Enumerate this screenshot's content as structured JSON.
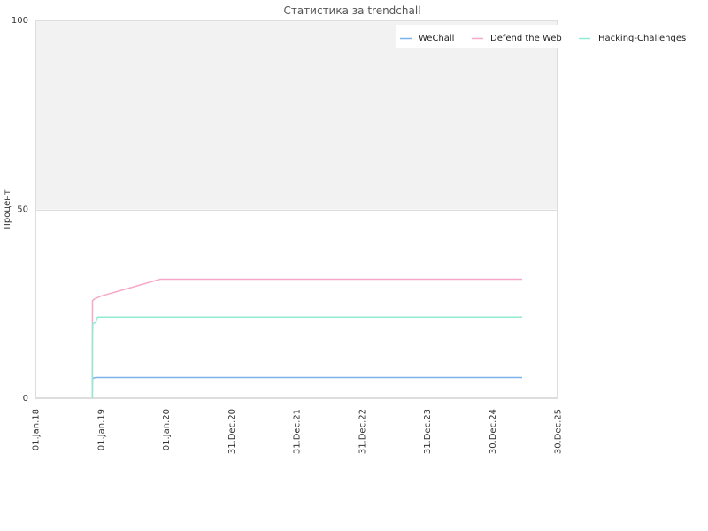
{
  "chart_data": {
    "type": "line",
    "title": "Статистика за trendchall",
    "xlabel": "",
    "ylabel": "Процент",
    "ylim": [
      0,
      100
    ],
    "yticks": [
      0,
      50,
      100
    ],
    "xlim": [
      "2018-01-01",
      "2025-12-30"
    ],
    "xtick_labels": [
      "01.Jan.18",
      "01.Jan.19",
      "01.Jan.20",
      "31.Dec.20",
      "31.Dec.21",
      "31.Dec.22",
      "31.Dec.23",
      "30.Dec.24",
      "30.Dec.25"
    ],
    "xtick_dates": [
      "2018-01-01",
      "2019-01-01",
      "2020-01-01",
      "2020-12-31",
      "2021-12-31",
      "2022-12-31",
      "2023-12-31",
      "2024-12-30",
      "2025-12-30"
    ],
    "shaded_band": {
      "from": 50,
      "to": 100,
      "color": "#f2f2f2"
    },
    "legend_position": "top-right",
    "series": [
      {
        "name": "WeChall",
        "color": "#7cb5ec",
        "points": [
          [
            "2018-11-15",
            0
          ],
          [
            "2018-11-16",
            5.2
          ],
          [
            "2018-11-25",
            5.4
          ],
          [
            "2018-12-10",
            5.5
          ],
          [
            "2025-06-15",
            5.5
          ]
        ]
      },
      {
        "name": "Defend the Web",
        "color": "#f7a8c8",
        "points": [
          [
            "2018-11-15",
            0
          ],
          [
            "2018-11-16",
            25.8
          ],
          [
            "2018-11-25",
            26.2
          ],
          [
            "2019-01-01",
            27.0
          ],
          [
            "2019-12-01",
            31.5
          ],
          [
            "2025-06-15",
            31.5
          ]
        ]
      },
      {
        "name": "Hacking-Challenges",
        "color": "#90ebd0",
        "points": [
          [
            "2018-11-15",
            0
          ],
          [
            "2018-11-16",
            16.5
          ],
          [
            "2018-11-18",
            19.8
          ],
          [
            "2018-12-05",
            20.1
          ],
          [
            "2018-12-15",
            21.5
          ],
          [
            "2025-06-15",
            21.5
          ]
        ]
      }
    ]
  }
}
